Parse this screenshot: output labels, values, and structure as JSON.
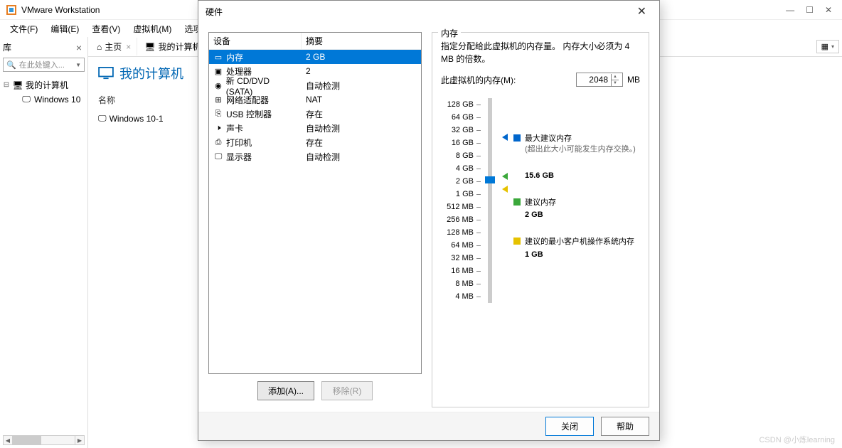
{
  "app": {
    "title": "VMware Workstation"
  },
  "menubar": {
    "items": [
      "文件(F)",
      "编辑(E)",
      "查看(V)",
      "虚拟机(M)",
      "选项卡(T)"
    ]
  },
  "library": {
    "title": "库",
    "search_placeholder": "在此处键入...",
    "root": "我的计算机",
    "child": "Windows 10"
  },
  "tabs": {
    "home": "主页",
    "current": "我的计算机"
  },
  "main": {
    "title": "我的计算机",
    "name_label": "名称",
    "vm_name": "Windows 10-1"
  },
  "dialog": {
    "title": "硬件",
    "device_header": "设备",
    "summary_header": "摘要",
    "devices": [
      {
        "name": "内存",
        "summary": "2 GB",
        "icon": "mem"
      },
      {
        "name": "处理器",
        "summary": "2",
        "icon": "cpu"
      },
      {
        "name": "新 CD/DVD (SATA)",
        "summary": "自动检测",
        "icon": "cd"
      },
      {
        "name": "网络适配器",
        "summary": "NAT",
        "icon": "net"
      },
      {
        "name": "USB 控制器",
        "summary": "存在",
        "icon": "usb"
      },
      {
        "name": "声卡",
        "summary": "自动检测",
        "icon": "sound"
      },
      {
        "name": "打印机",
        "summary": "存在",
        "icon": "printer"
      },
      {
        "name": "显示器",
        "summary": "自动检测",
        "icon": "display"
      }
    ],
    "add_button": "添加(A)...",
    "remove_button": "移除(R)",
    "memory": {
      "group_title": "内存",
      "description": "指定分配给此虚拟机的内存量。 内存大小必须为 4 MB 的倍数。",
      "input_label": "此虚拟机的内存(M):",
      "input_value": "2048",
      "unit": "MB",
      "scale": [
        "128 GB",
        "64 GB",
        "32 GB",
        "16 GB",
        "8 GB",
        "4 GB",
        "2 GB",
        "1 GB",
        "512 MB",
        "256 MB",
        "128 MB",
        "64 MB",
        "32 MB",
        "16 MB",
        "8 MB",
        "4 MB"
      ],
      "legend_max": "最大建议内存",
      "legend_max_sub": "(超出此大小可能发生内存交换。)",
      "legend_max_value": "15.6 GB",
      "legend_rec": "建议内存",
      "legend_rec_value": "2 GB",
      "legend_min": "建议的最小客户机操作系统内存",
      "legend_min_value": "1 GB"
    },
    "close_button": "关闭",
    "help_button": "帮助"
  },
  "watermark": "CSDN @小炼learning"
}
